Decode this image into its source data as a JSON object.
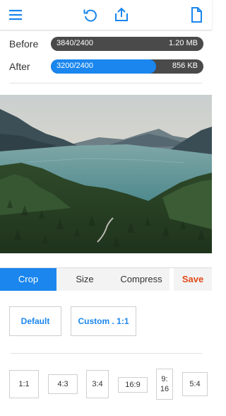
{
  "toolbar": {
    "icons": [
      "menu-icon",
      "rotate-icon",
      "share-icon",
      "file-icon"
    ],
    "accent": "#1a86ee"
  },
  "before": {
    "label": "Before",
    "dimensions": "3840/2400",
    "file_size": "1.20 MB",
    "fill": 1.0
  },
  "after": {
    "label": "After",
    "dimensions": "3200/2400",
    "file_size": "856 KB",
    "fill": 0.69
  },
  "tabs": [
    {
      "label": "Crop",
      "active": true
    },
    {
      "label": "Size",
      "active": false
    },
    {
      "label": "Compress",
      "active": false
    }
  ],
  "save_label": "Save",
  "presets": {
    "default_label": "Default",
    "custom_label": "Custom . 1:1"
  },
  "ratios": [
    "1:1",
    "4:3",
    "3:4",
    "16:9",
    "9:\n16",
    "5:4"
  ],
  "colors": {
    "accent": "#1a86ee",
    "save": "#e24a1a",
    "bar_bg": "#4a4a4a"
  }
}
